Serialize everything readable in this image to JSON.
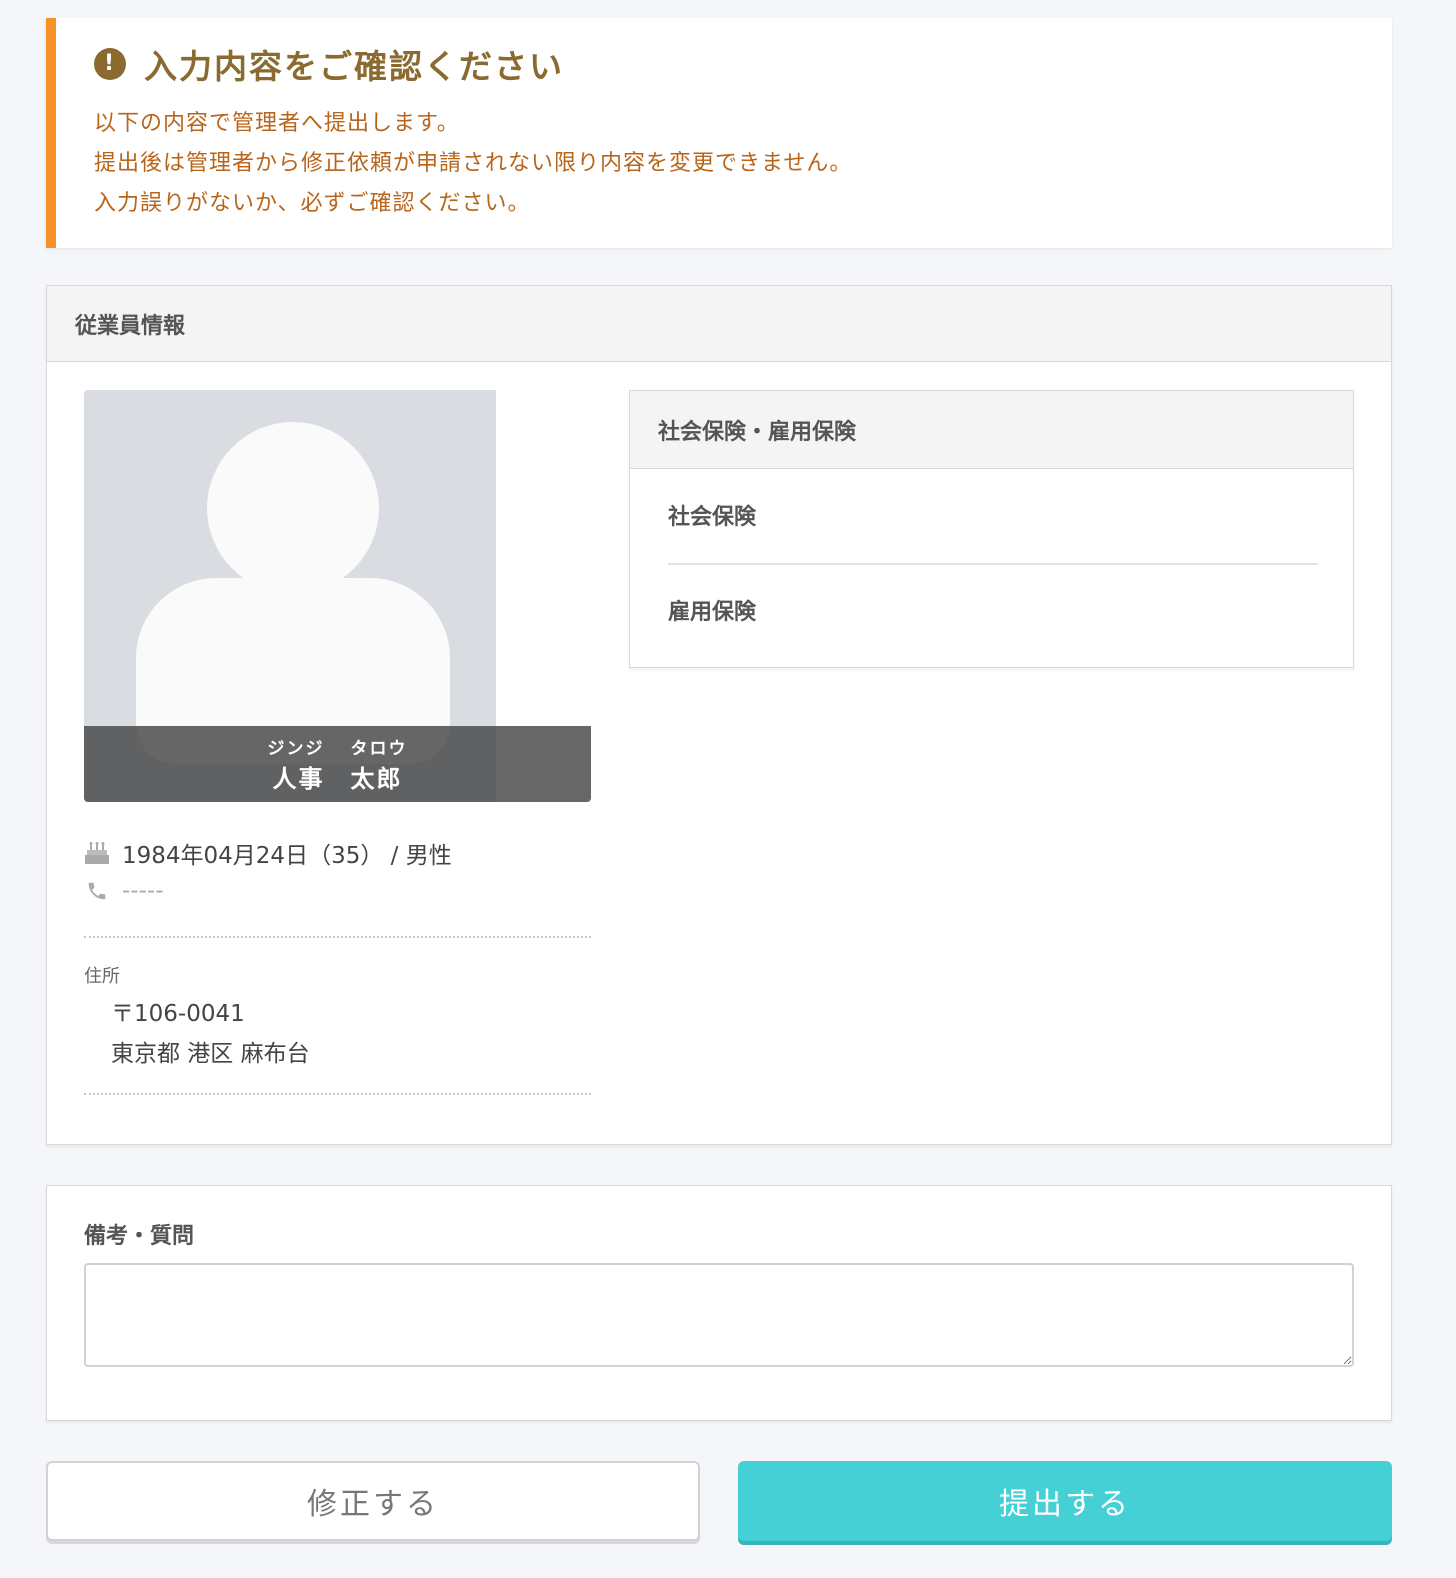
{
  "alert": {
    "icon": "exclamation-circle-icon",
    "icon_glyph": "!",
    "title": "入力内容をご確認ください",
    "lines": [
      "以下の内容で管理者へ提出します。",
      "提出後は管理者から修正依頼が申請されない限り内容を変更できません。",
      "入力誤りがないか、必ずご確認ください。"
    ]
  },
  "employee": {
    "header": "従業員情報",
    "kana_last": "ジンジ",
    "kana_first": "タロウ",
    "name_last": "人事",
    "name_first": "太郎",
    "birthday": "1984年04月24日（35） / 男性",
    "phone": "-----",
    "address_label": "住所",
    "postal": "〒106-0041",
    "address": "東京都 港区 麻布台"
  },
  "insurance": {
    "header": "社会保険・雇用保険",
    "items": [
      "社会保険",
      "雇用保険"
    ]
  },
  "notes": {
    "title": "備考・質問",
    "value": ""
  },
  "buttons": {
    "edit": "修正する",
    "submit": "提出する"
  },
  "colors": {
    "accent_orange": "#f7922a",
    "alert_text": "#b8651a",
    "submit": "#45d0d6"
  }
}
